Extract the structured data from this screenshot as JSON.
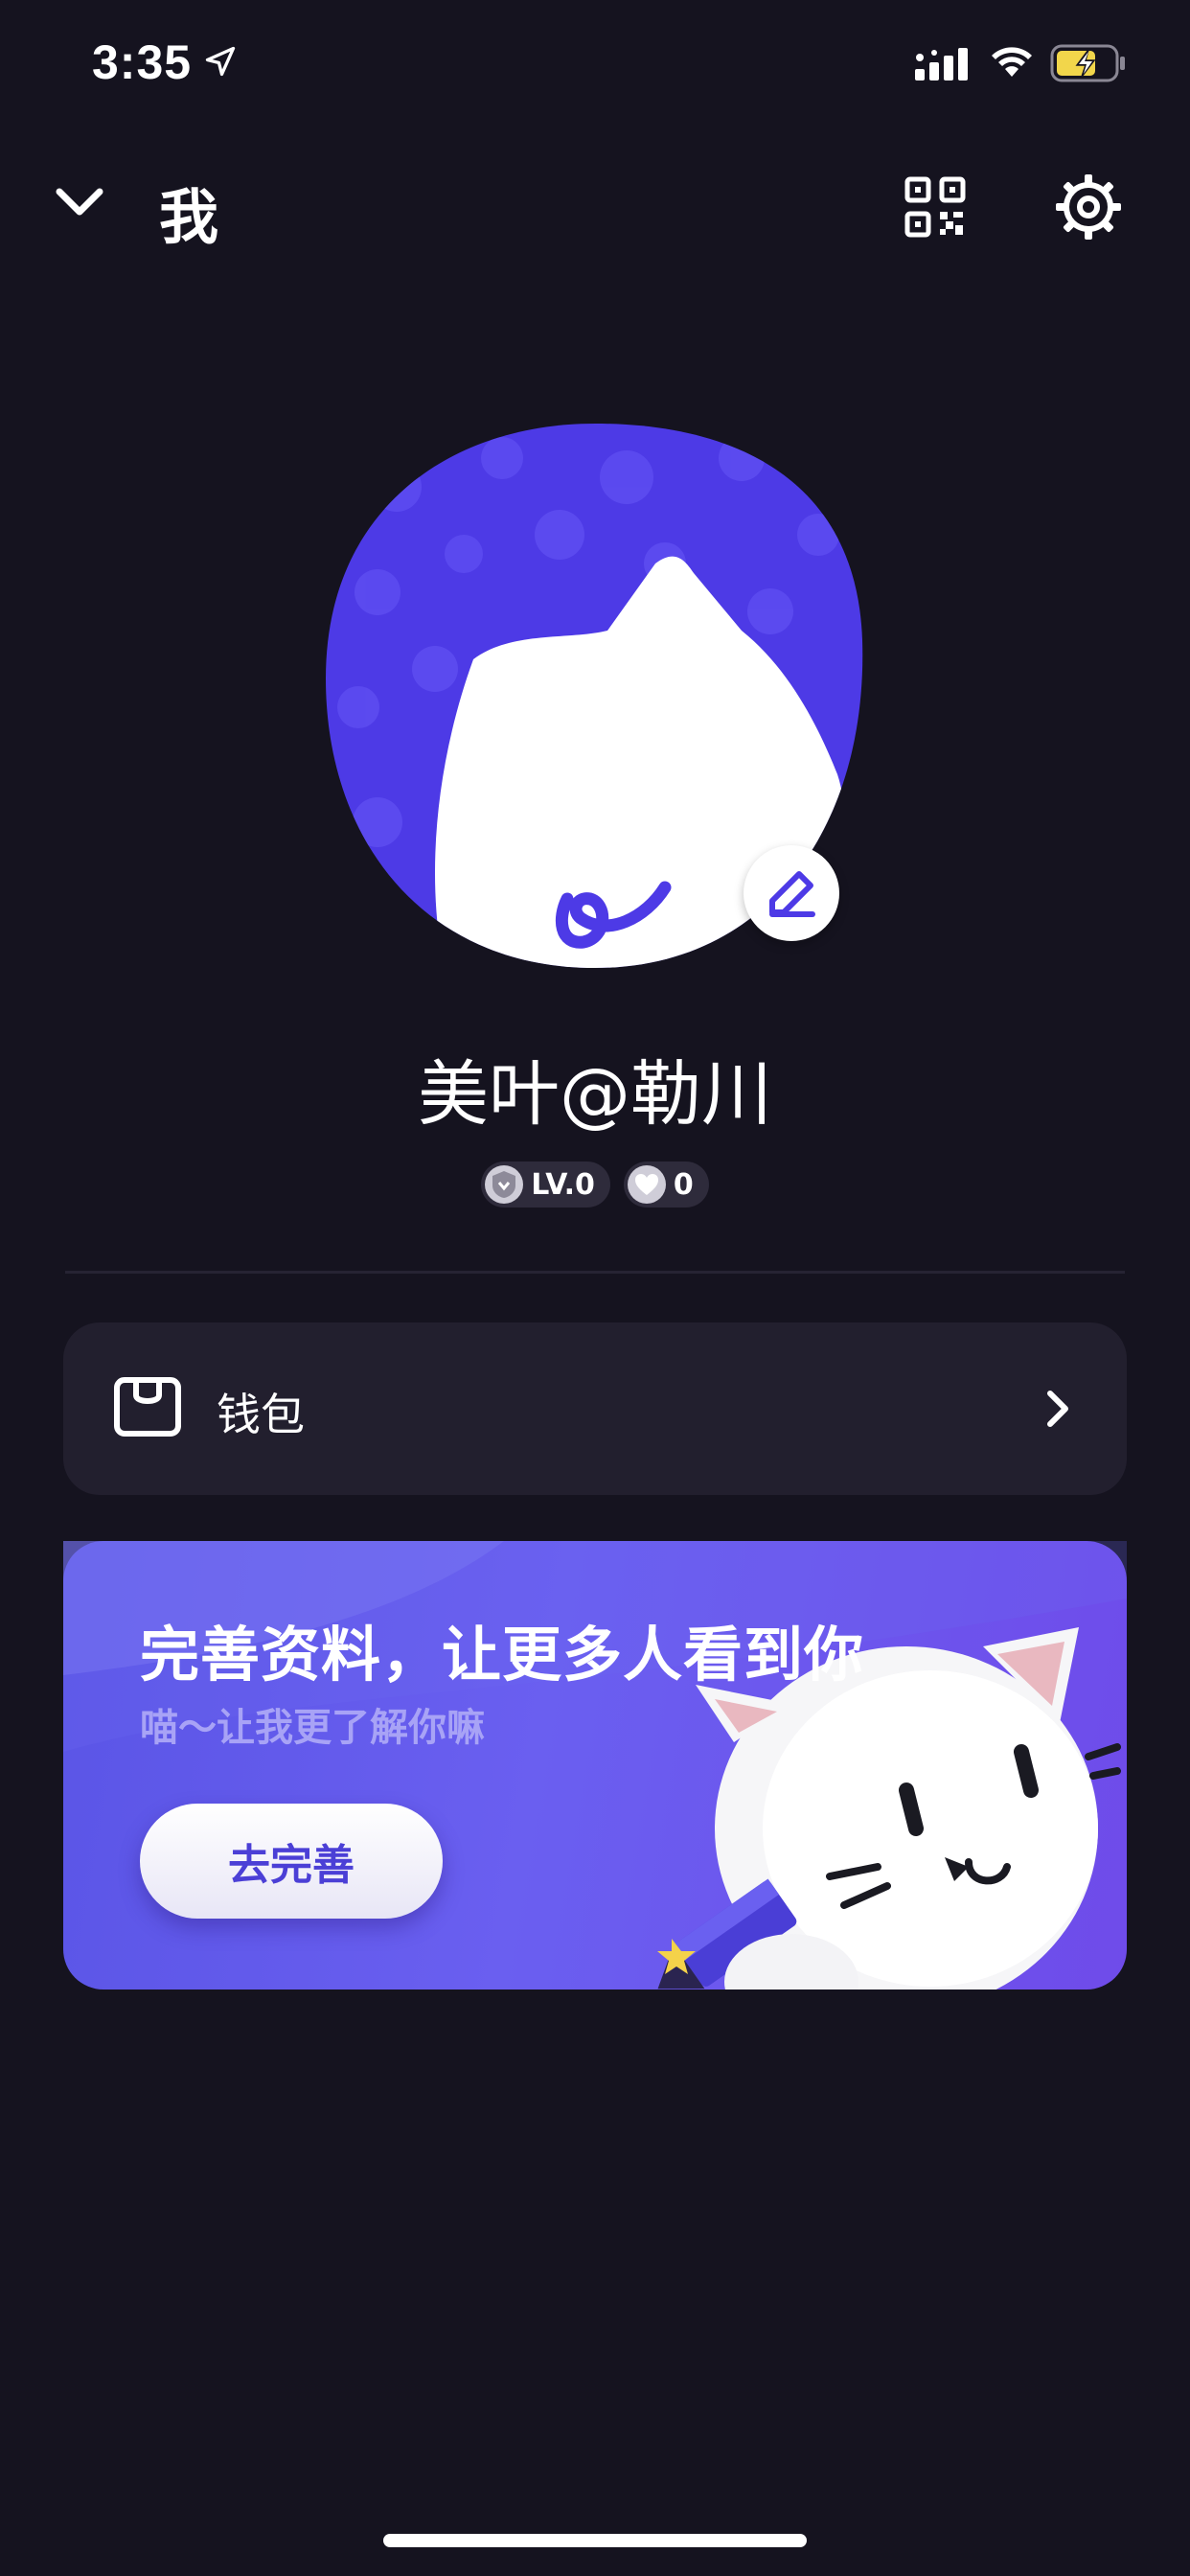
{
  "status_bar": {
    "time": "3:35"
  },
  "header": {
    "title": "我"
  },
  "profile": {
    "username": "美叶@勒川",
    "level_badge": "LV.0",
    "heart_badge": "0"
  },
  "wallet": {
    "label": "钱包"
  },
  "banner": {
    "title": "完善资料，让更多人看到你",
    "subtitle": "喵～让我更了解你嘛",
    "button_label": "去完善"
  },
  "colors": {
    "background": "#15131f",
    "card": "#221f2e",
    "accent": "#5548e8",
    "banner_button_text": "#4b3fd6"
  }
}
